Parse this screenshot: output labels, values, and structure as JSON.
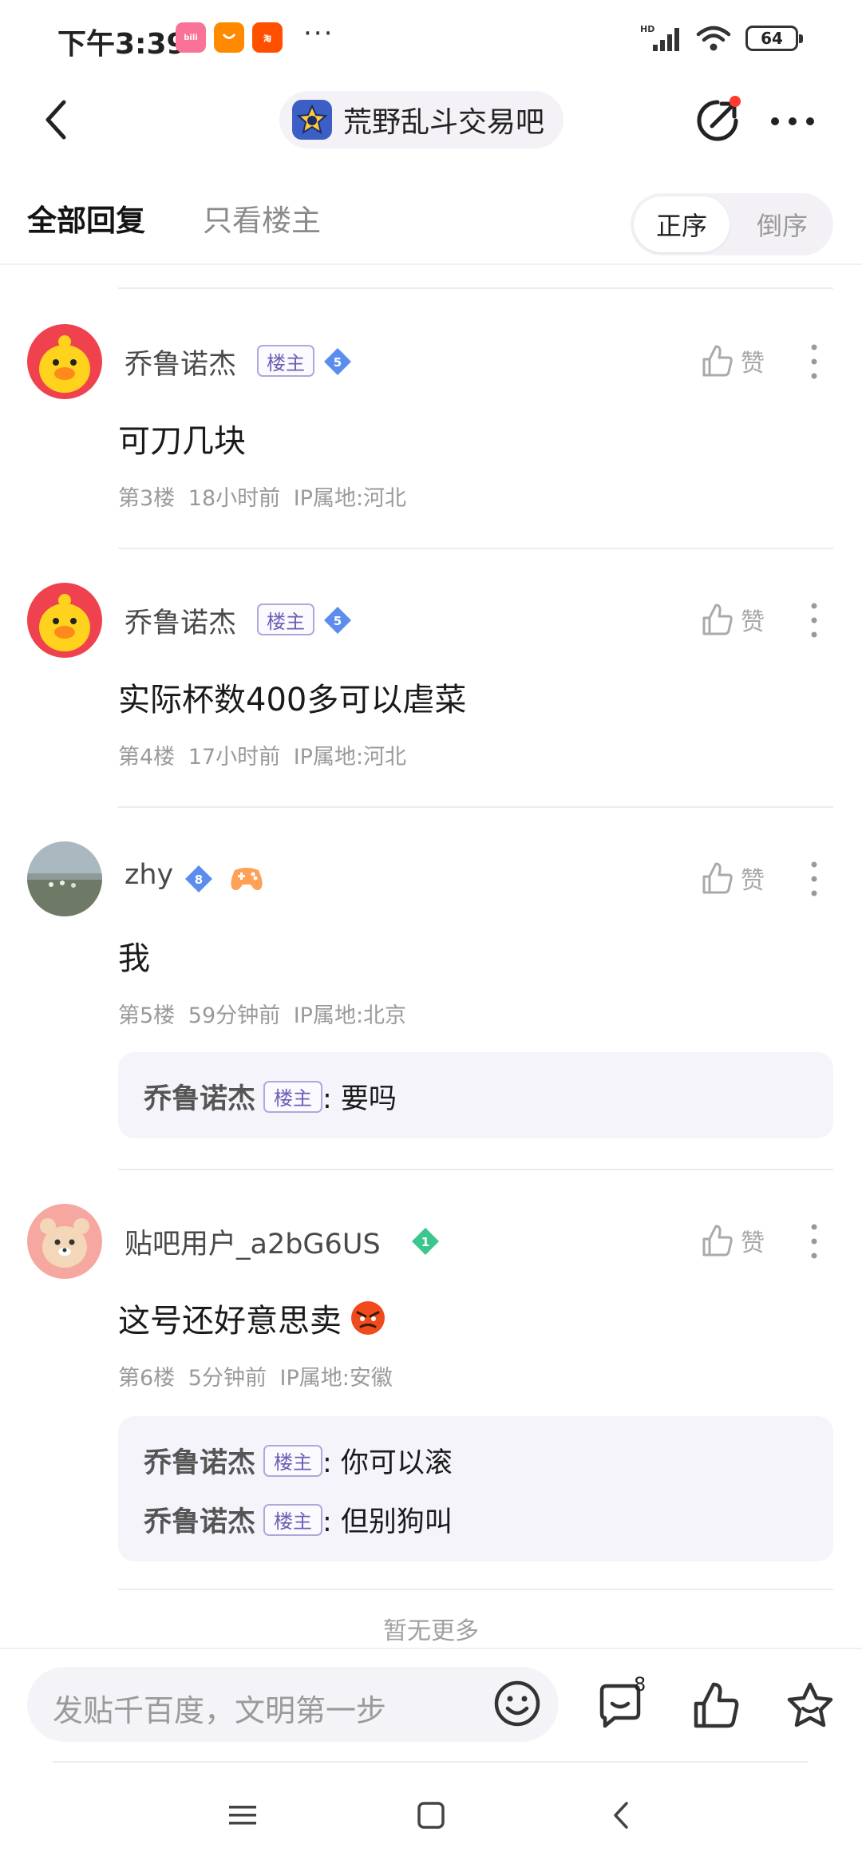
{
  "status_bar": {
    "time": "下午3:39",
    "app_icons": [
      "bilibili",
      "alibaba",
      "taobao 11.11"
    ],
    "more": "···",
    "network": "HD",
    "battery": "64"
  },
  "header": {
    "forum_name": "荒野乱斗交易吧",
    "icons": [
      "back-icon",
      "share-icon",
      "more-icon"
    ]
  },
  "tabs": {
    "all_replies": "全部回复",
    "owner_only": "只看楼主",
    "sort_asc": "正序",
    "sort_desc": "倒序"
  },
  "posts": [
    {
      "username": "乔鲁诺杰",
      "owner_badge": "楼主",
      "level": "5",
      "like_label": "赞",
      "content": "可刀几块",
      "meta": "第3楼  18小时前  IP属地:河北"
    },
    {
      "username": "乔鲁诺杰",
      "owner_badge": "楼主",
      "level": "5",
      "like_label": "赞",
      "content": "实际杯数400多可以虐菜",
      "meta": "第4楼  17小时前  IP属地:河北"
    },
    {
      "username": "zhy",
      "level": "8",
      "like_label": "赞",
      "content": "我",
      "meta": "第5楼  59分钟前  IP属地:北京",
      "replies": [
        {
          "author": "乔鲁诺杰",
          "badge": "楼主",
          "text": ": 要吗"
        }
      ]
    },
    {
      "username": "贴吧用户_a2bG6US",
      "level": "1",
      "like_label": "赞",
      "content": "这号还好意思卖",
      "meta": "第6楼  5分钟前  IP属地:安徽",
      "replies": [
        {
          "author": "乔鲁诺杰",
          "badge": "楼主",
          "text": ": 你可以滚"
        },
        {
          "author": "乔鲁诺杰",
          "badge": "楼主",
          "text": ": 但别狗叫"
        }
      ]
    }
  ],
  "no_more": "暂无更多",
  "bottom_bar": {
    "placeholder": "发贴千百度，文明第一步",
    "reply_count": "8"
  },
  "colors": {
    "owner_badge": "#6b5fb5",
    "level_gem_blue": "#5b8def",
    "level_gem_green": "#3cc58c",
    "reply_box_bg": "#f5f4fb",
    "notification_dot": "#ff3b30"
  }
}
